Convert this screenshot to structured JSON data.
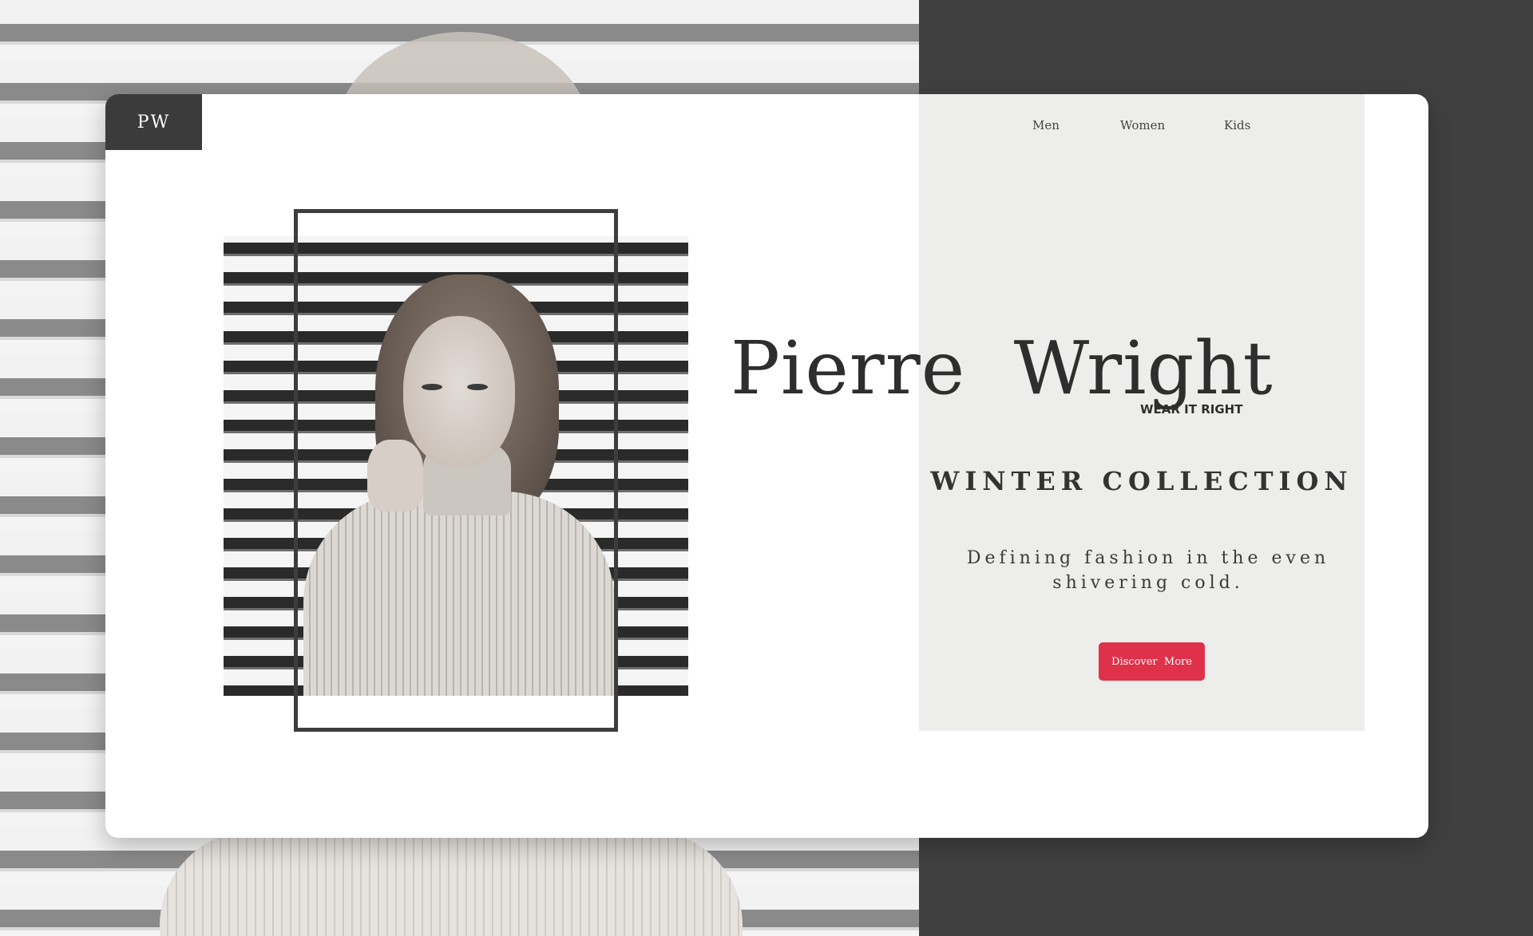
{
  "logo": {
    "text": "PW"
  },
  "nav": {
    "items": [
      {
        "label": "Men"
      },
      {
        "label": "Women"
      },
      {
        "label": "Kids"
      }
    ]
  },
  "hero": {
    "brand_name": "Pierre  Wright",
    "tagline": "WEAR IT RIGHT",
    "collection_title": "WINTER COLLECTION",
    "description": "Defining fashion in the even shivering cold.",
    "cta_label": "Discover  More"
  },
  "colors": {
    "accent": "#e0314a",
    "dark": "#404040",
    "panel": "#ededeb",
    "card": "#ffffff"
  }
}
